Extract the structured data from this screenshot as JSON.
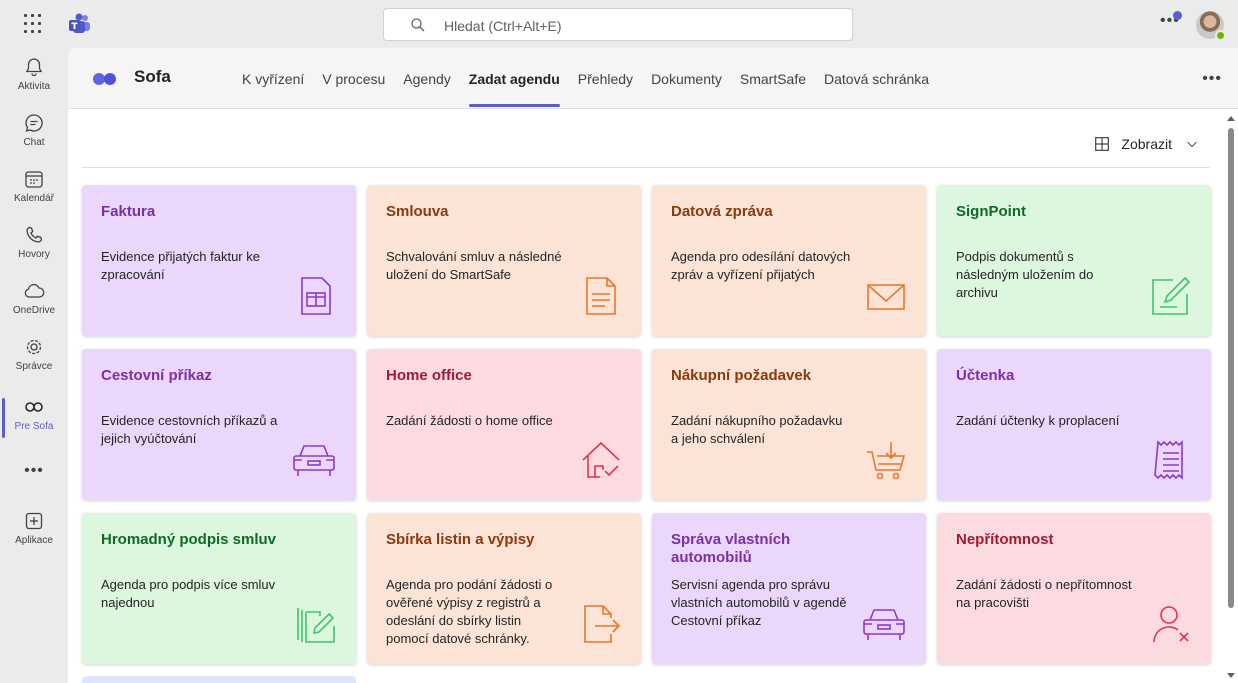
{
  "search": {
    "placeholder": "Hledat (Ctrl+Alt+E)"
  },
  "rail": {
    "items": [
      {
        "label": "Aktivita",
        "icon": "bell-icon"
      },
      {
        "label": "Chat",
        "icon": "chat-icon"
      },
      {
        "label": "Kalendář",
        "icon": "calendar-icon"
      },
      {
        "label": "Hovory",
        "icon": "phone-icon"
      },
      {
        "label": "OneDrive",
        "icon": "cloud-icon"
      },
      {
        "label": "Správce",
        "icon": "admin-gear-icon"
      },
      {
        "label": "Pre Sofa",
        "icon": "sofa-app-icon",
        "active": true
      },
      {
        "label": "Aplikace",
        "icon": "plus-square-icon"
      }
    ],
    "more": "•••"
  },
  "app": {
    "name": "Sofa",
    "tabs": [
      {
        "label": "K vyřízení"
      },
      {
        "label": "V procesu"
      },
      {
        "label": "Agendy"
      },
      {
        "label": "Zadat agendu",
        "active": true
      },
      {
        "label": "Přehledy"
      },
      {
        "label": "Dokumenty"
      },
      {
        "label": "SmartSafe"
      },
      {
        "label": "Datová schránka"
      }
    ],
    "more": "•••"
  },
  "toolbar": {
    "view_label": "Zobrazit"
  },
  "cards": [
    {
      "title": "Faktura",
      "desc": "Evidence přijatých faktur ke zpracování",
      "color": "#7b2fa8",
      "icon": "invoice-icon"
    },
    {
      "title": "Smlouva",
      "desc": "Schvalování smluv a následné uložení do SmartSafe",
      "color": "#e8772e",
      "icon": "document-icon"
    },
    {
      "title": "Datová zpráva",
      "desc": "Agenda pro odesílání datových zpráv a vyřízení přijatých",
      "color": "#e8772e",
      "icon": "envelope-icon"
    },
    {
      "title": "SignPoint",
      "desc": "Podpis dokumentů s následným uložením do archivu",
      "color": "#3ec46d",
      "icon": "sign-edit-icon"
    },
    {
      "title": "Cestovní příkaz",
      "desc": "Evidence cestovních příkazů a jejich vyúčtování",
      "color": "#8e3ac4",
      "icon": "car-icon"
    },
    {
      "title": "Home office",
      "desc": "Zadání žádosti o home office",
      "color": "#e2334f",
      "icon": "home-check-icon"
    },
    {
      "title": "Nákupní požadavek",
      "desc": "Zadání nákupního požadavku a jeho schválení",
      "color": "#e8772e",
      "icon": "cart-icon"
    },
    {
      "title": "Účtenka",
      "desc": "Zadání účtenky k proplacení",
      "color": "#8e3ac4",
      "icon": "receipt-icon"
    },
    {
      "title": "Hromadný podpis smluv",
      "desc": "Agenda pro podpis více smluv najednou",
      "color": "#3ec46d",
      "icon": "multi-sign-icon"
    },
    {
      "title": "Sbírka listin a výpisy",
      "desc": "Agenda pro podání žádosti o ověřené výpisy z registrů a odeslání do sbírky listin pomocí datové schránky.",
      "color": "#e8772e",
      "icon": "file-export-icon"
    },
    {
      "title": "Správa vlastních automobilů",
      "desc": "Servisní agenda pro správu vlastních automobilů v agendě Cestovní příkaz",
      "color": "#8e3ac4",
      "icon": "car-icon"
    },
    {
      "title": "Nepřítomnost",
      "desc": "Zadání žádosti o nepřítomnost na pracovišti",
      "color": "#e2334f",
      "icon": "person-x-icon"
    }
  ]
}
